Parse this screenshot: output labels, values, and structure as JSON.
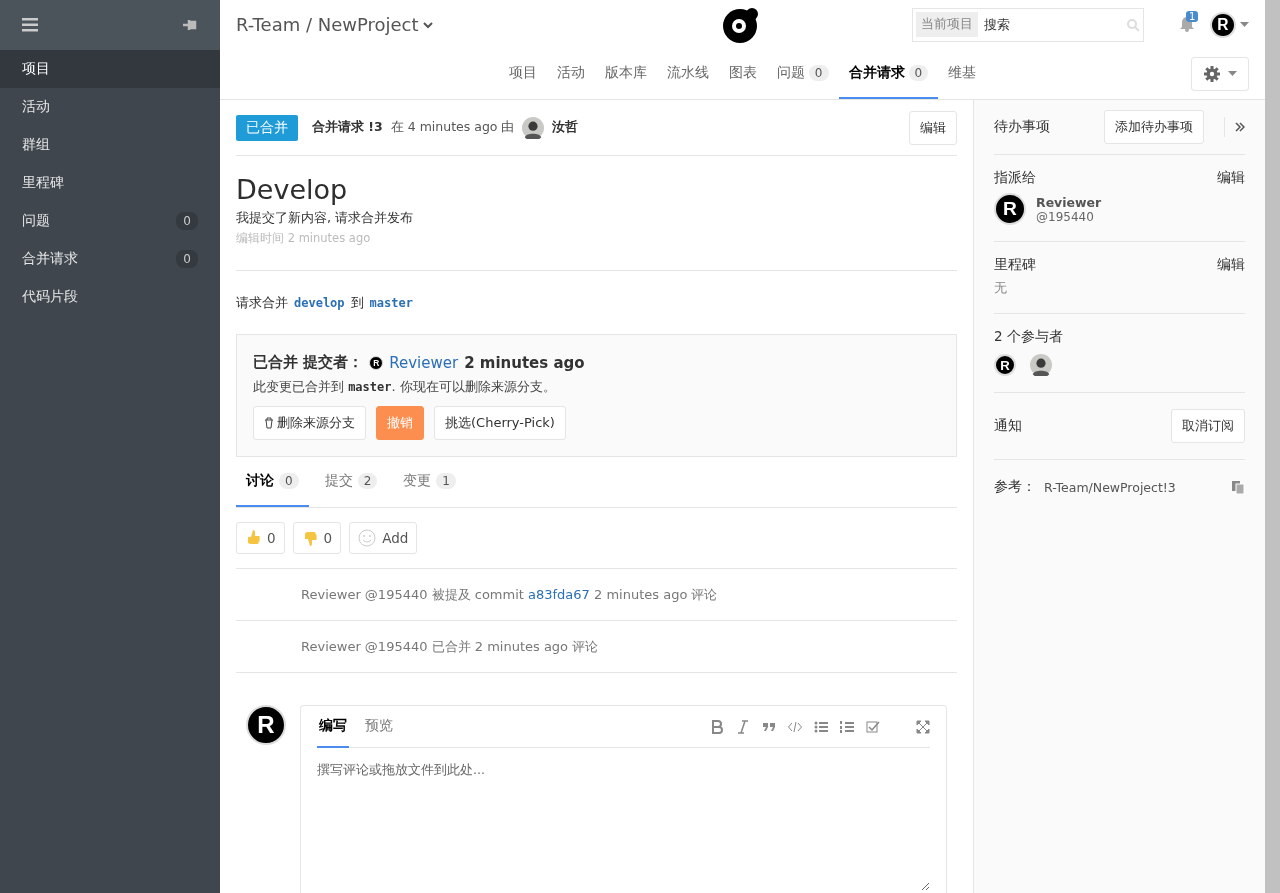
{
  "sidebar": {
    "items": [
      {
        "label": "项目",
        "selected": true
      },
      {
        "label": "活动",
        "selected": false
      },
      {
        "label": "群组",
        "selected": false
      },
      {
        "label": "里程碑",
        "selected": false
      },
      {
        "label": "问题",
        "selected": false,
        "count": "0"
      },
      {
        "label": "合并请求",
        "selected": false,
        "count": "0"
      },
      {
        "label": "代码片段",
        "selected": false
      }
    ]
  },
  "header": {
    "breadcrumb": "R-Team / NewProject",
    "search": {
      "scope": "当前项目",
      "placeholder": "搜索"
    },
    "notifications": "1",
    "user_avatar": "R",
    "nav": [
      {
        "label": "项目",
        "selected": false
      },
      {
        "label": "活动",
        "selected": false
      },
      {
        "label": "版本库",
        "selected": false
      },
      {
        "label": "流水线",
        "selected": false
      },
      {
        "label": "图表",
        "selected": false
      },
      {
        "label": "问题",
        "selected": false,
        "count": "0"
      },
      {
        "label": "合并请求",
        "selected": true,
        "count": "0"
      },
      {
        "label": "维基",
        "selected": false
      }
    ]
  },
  "merge_request": {
    "status": "已合并",
    "ref": "合并请求 !3",
    "opened": "在 4 minutes ago 由",
    "author": "汝哲",
    "edit": "编辑",
    "title": "Develop",
    "description": "我提交了新内容, 请求合并发布",
    "edited": "编辑时间 2 minutes ago",
    "branches": {
      "prefix": "请求合并",
      "source": "develop",
      "middle": "到",
      "target": "master"
    },
    "merged_box": {
      "title": "已合并 提交者：",
      "avatar": "R",
      "user": "Reviewer",
      "time": "2 minutes ago",
      "message_start": "此变更已合并到",
      "branch": "master",
      "message_end": ". 你现在可以删除来源分支。",
      "buttons": [
        {
          "kind": "remove",
          "label": "删除来源分支"
        },
        {
          "kind": "revert",
          "label": "撤销"
        },
        {
          "kind": "plain",
          "label": "挑选(Cherry-Pick)"
        }
      ]
    },
    "tabs": [
      {
        "label": "讨论",
        "count": "0",
        "selected": true
      },
      {
        "label": "提交",
        "count": "2",
        "selected": false
      },
      {
        "label": "变更",
        "count": "1",
        "selected": false
      }
    ],
    "awards": [
      {
        "kind": "thumbsup",
        "label": "0"
      },
      {
        "kind": "thumbsdown",
        "label": "0"
      },
      {
        "kind": "add",
        "label": "Add"
      }
    ],
    "notes": [
      {
        "text": "Reviewer @195440 被提及 commit",
        "link": "a83fda67",
        "after": "2 minutes ago 评论"
      },
      {
        "text": "Reviewer @195440 已合并 2 minutes ago 评论"
      }
    ],
    "comment": {
      "avatar": "R",
      "tabs": [
        {
          "label": "编写",
          "selected": true
        },
        {
          "label": "预览",
          "selected": false
        }
      ],
      "placeholder": "撰写评论或拖放文件到此处..."
    }
  },
  "right_sidebar": {
    "todo": {
      "label": "待办事项",
      "button": "添加待办事项"
    },
    "assignee": {
      "label": "指派给",
      "edit": "编辑",
      "avatar": "R",
      "name": "Reviewer",
      "username": "@195440"
    },
    "milestone": {
      "label": "里程碑",
      "edit": "编辑",
      "value": "无"
    },
    "participants": {
      "label": "2 个参与者",
      "avatar": "R"
    },
    "notifications": {
      "label": "通知",
      "button": "取消订阅"
    },
    "reference": {
      "label": "参考：",
      "value": "R-Team/NewProject!3"
    }
  }
}
